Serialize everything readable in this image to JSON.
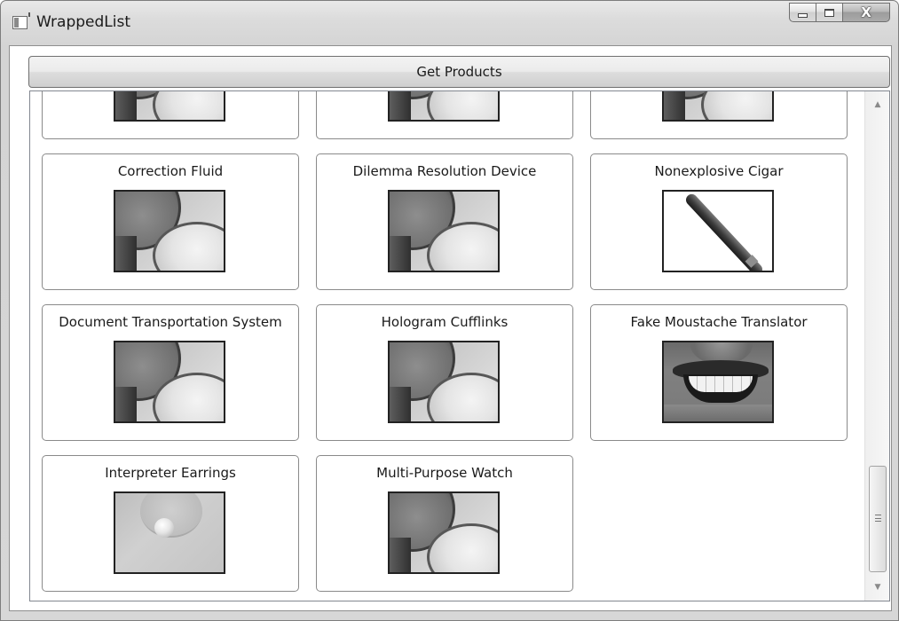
{
  "window": {
    "title": "WrappedList",
    "controls": {
      "close_glyph": "X"
    }
  },
  "toolbar": {
    "get_products_label": "Get Products"
  },
  "products": [
    {
      "name": "",
      "image": "compact-mirror"
    },
    {
      "name": "",
      "image": "compact-mirror"
    },
    {
      "name": "",
      "image": "compact-mirror"
    },
    {
      "name": "Correction Fluid",
      "image": "compact-mirror"
    },
    {
      "name": "Dilemma Resolution Device",
      "image": "compact-mirror"
    },
    {
      "name": "Nonexplosive Cigar",
      "image": "cigar"
    },
    {
      "name": "Document Transportation System",
      "image": "compact-mirror"
    },
    {
      "name": "Hologram Cufflinks",
      "image": "compact-mirror"
    },
    {
      "name": "Fake Moustache Translator",
      "image": "moustache-face"
    },
    {
      "name": "Interpreter Earrings",
      "image": "ear-earring"
    },
    {
      "name": "Multi-Purpose Watch",
      "image": "compact-mirror"
    }
  ],
  "scrollbar": {
    "up_icon": "scroll-up-arrow-icon",
    "down_icon": "scroll-down-arrow-icon",
    "position_fraction": 0.95
  }
}
